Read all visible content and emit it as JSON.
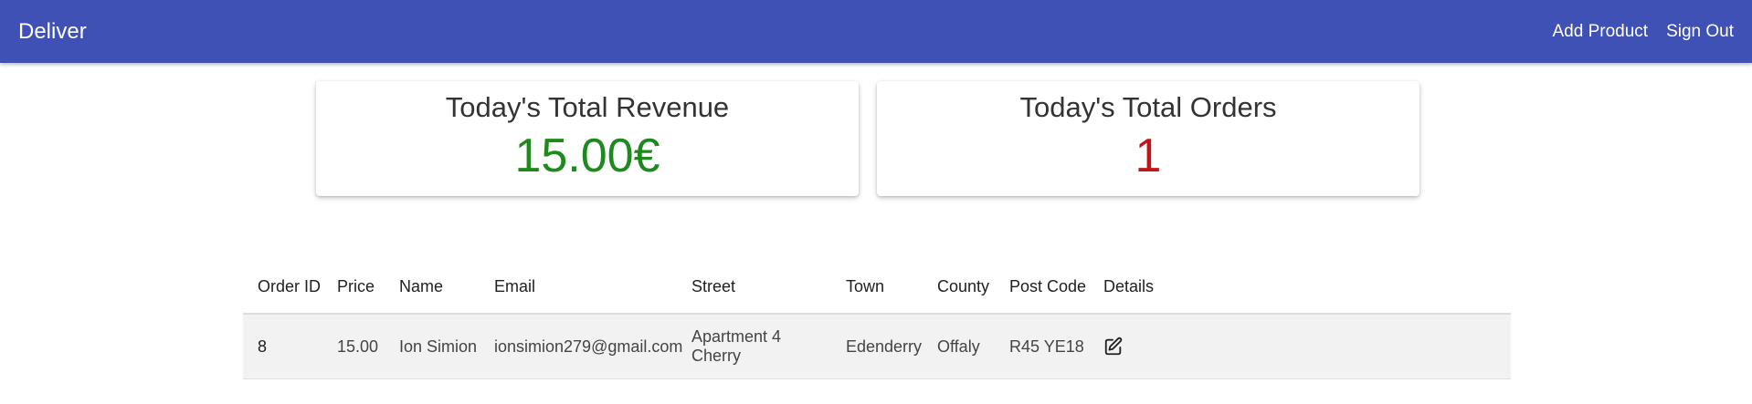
{
  "navbar": {
    "brand": "Deliver",
    "links": [
      {
        "label": "Add Product"
      },
      {
        "label": "Sign Out"
      }
    ],
    "color": "#3f51b5"
  },
  "stats": {
    "revenue": {
      "title": "Today's Total Revenue",
      "value": "15.00€",
      "color": "#1e8a1e"
    },
    "orders": {
      "title": "Today's Total Orders",
      "value": "1",
      "color": "#c0161b"
    }
  },
  "table": {
    "columns": [
      "Order ID",
      "Price",
      "Name",
      "Email",
      "Street",
      "Town",
      "County",
      "Post Code",
      "Details"
    ],
    "rows": [
      {
        "order_id": "8",
        "price": "15.00",
        "name": "Ion Simion",
        "email": "ionsimion279@gmail.com",
        "street": "Apartment 4 Cherry",
        "town": "Edenderry",
        "county": "Offaly",
        "post_code": "R45 YE18",
        "details_icon": "edit-icon"
      }
    ]
  }
}
